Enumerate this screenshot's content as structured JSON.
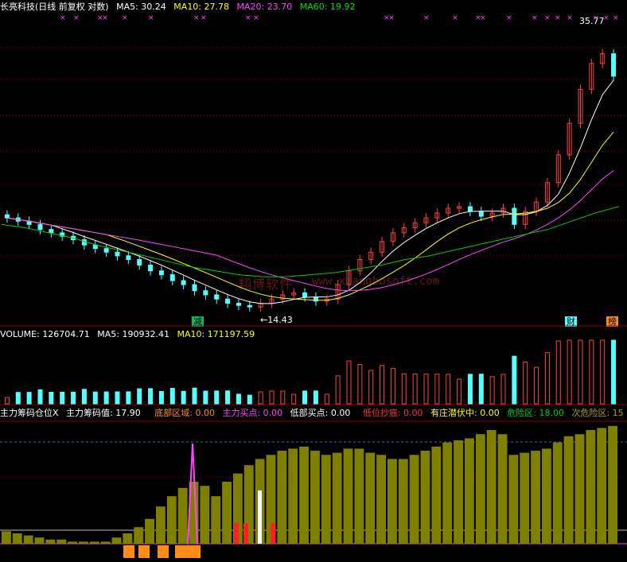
{
  "main_panel": {
    "title": "长亮科技(日线 前复权 对数)",
    "ma5": "MA5: 30.24",
    "ma10": "MA10: 27.78",
    "ma20": "MA20: 23.70",
    "ma60": "MA60: 19.92",
    "high_label": "35.77",
    "low_label": "←14.43",
    "signal_jian": "减",
    "signal_cai": "财",
    "signal_bang": "榜"
  },
  "watermark": {
    "cn": "翔博软件",
    "url": "www.xiangbosoft.com"
  },
  "volume_panel": {
    "volume": "VOLUME: 126704.71",
    "ma5": "MA5: 190932.41",
    "ma10": "MA10: 171197.59"
  },
  "indicator_panel": {
    "name": "主力筹码仓位X",
    "value": "主力筹码值: 17.90",
    "bottom_zone": "底部区域: 0.00",
    "main_buy": "主力买点: 0.00",
    "low_buy": "低部买点: 0.00",
    "low_bottom": "低位抄底: 0.00",
    "hidden": "有庄潜伏中: 0.00",
    "danger": "危险区: 18.00",
    "sub_danger": "次危险区: 15"
  },
  "colors": {
    "up": "#ff4040",
    "down": "#54ffff",
    "ma5": "#ffffff",
    "ma10": "#ffff00",
    "ma20": "#ff44ff",
    "ma60": "#00cc00",
    "bar": "#808000",
    "orange": "#ff8c1a",
    "grid": "#8b0000"
  },
  "chart_data": {
    "type": "candlestick",
    "scale": "log",
    "high_marker": 35.77,
    "low_marker": 14.43,
    "close_series": [
      19.2,
      19.0,
      18.8,
      18.5,
      18.3,
      18.1,
      17.9,
      17.6,
      17.4,
      17.2,
      17.0,
      16.8,
      16.5,
      16.2,
      16.0,
      15.7,
      15.5,
      15.2,
      15.0,
      14.8,
      14.6,
      14.5,
      14.43,
      14.6,
      14.8,
      15.0,
      15.1,
      14.9,
      14.7,
      14.8,
      15.5,
      16.2,
      16.8,
      17.2,
      17.8,
      18.3,
      18.6,
      18.9,
      19.2,
      19.5,
      19.8,
      19.9,
      19.6,
      19.3,
      19.5,
      19.8,
      18.8,
      19.6,
      20.2,
      21.5,
      23.5,
      26.0,
      29.0,
      31.5,
      32.5,
      30.24
    ],
    "ma60_series": [
      18.8,
      18.6,
      18.3,
      18.0,
      17.6,
      17.3,
      17.0,
      16.7,
      16.4,
      16.2,
      16.0,
      15.9,
      15.9,
      16.0,
      16.1,
      16.3,
      16.5,
      16.8,
      17.0,
      17.3,
      17.6,
      17.9,
      18.2,
      18.5,
      19.0,
      19.5,
      19.92
    ],
    "indicator_series": [
      0.6,
      0.5,
      0.4,
      0.3,
      0.2,
      0.2,
      0.1,
      0.1,
      0.1,
      0.1,
      0.3,
      0.5,
      0.8,
      1.2,
      1.8,
      2.3,
      2.7,
      3.0,
      2.8,
      2.3,
      3.0,
      3.4,
      3.8,
      4.1,
      4.3,
      4.5,
      4.6,
      4.7,
      4.5,
      4.3,
      4.4,
      4.6,
      4.6,
      4.4,
      4.3,
      4.1,
      4.1,
      4.3,
      4.5,
      4.7,
      4.9,
      5.0,
      5.1,
      5.3,
      5.5,
      5.3,
      4.3,
      4.4,
      4.5,
      4.6,
      4.9,
      5.2,
      5.3,
      5.5,
      5.6,
      5.7
    ]
  }
}
